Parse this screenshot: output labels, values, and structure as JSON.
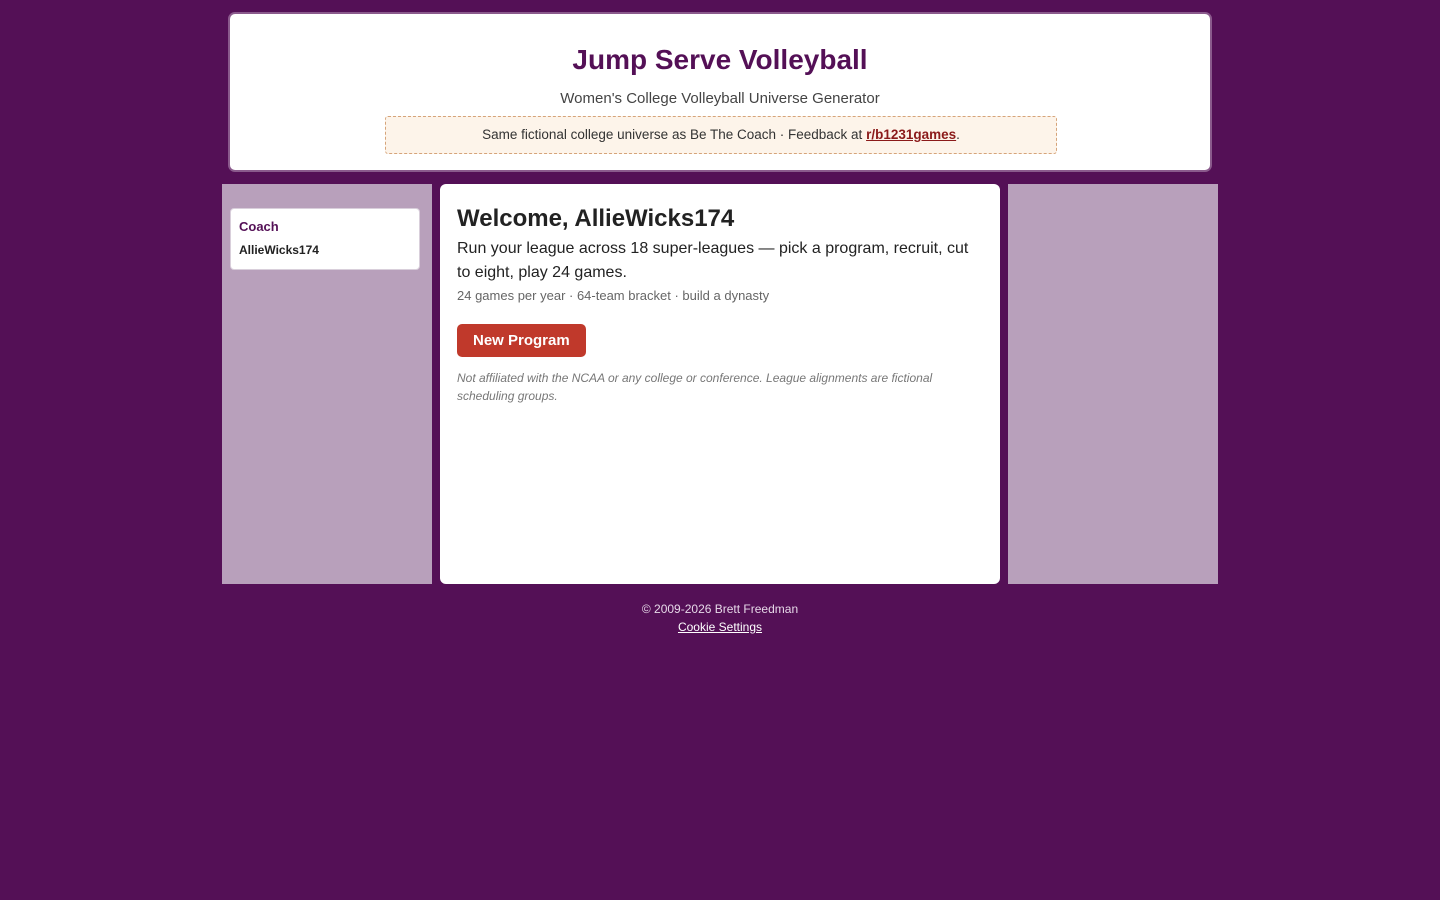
{
  "header": {
    "title": "Jump Serve Volleyball",
    "subtitle": "Women's College Volleyball Universe Generator",
    "notice_text": "Same fictional college universe as Be The Coach · Feedback at ",
    "notice_link": "r/b1231games",
    "notice_end": "."
  },
  "sidebar": {
    "coach_label": "Coach",
    "coach_name": "AllieWicks174"
  },
  "main": {
    "welcome": "Welcome, AllieWicks174",
    "lead": "Run your league across 18 super-leagues — pick a program, recruit, cut to eight, play 24 games.",
    "meta": "24 games per year · 64-team bracket · build a dynasty",
    "new_program_button": "New Program",
    "disclaimer": "Not affiliated with the NCAA or any college or conference. League alignments are fictional scheduling groups."
  },
  "footer": {
    "copyright": "© 2009-2026 Brett Freedman",
    "cookie_link": "Cookie Settings"
  },
  "colors": {
    "background": "#541056",
    "side_panel": "#b8a0bb",
    "accent": "#541056",
    "button": "#c0392b",
    "link": "#8b1a1a"
  }
}
